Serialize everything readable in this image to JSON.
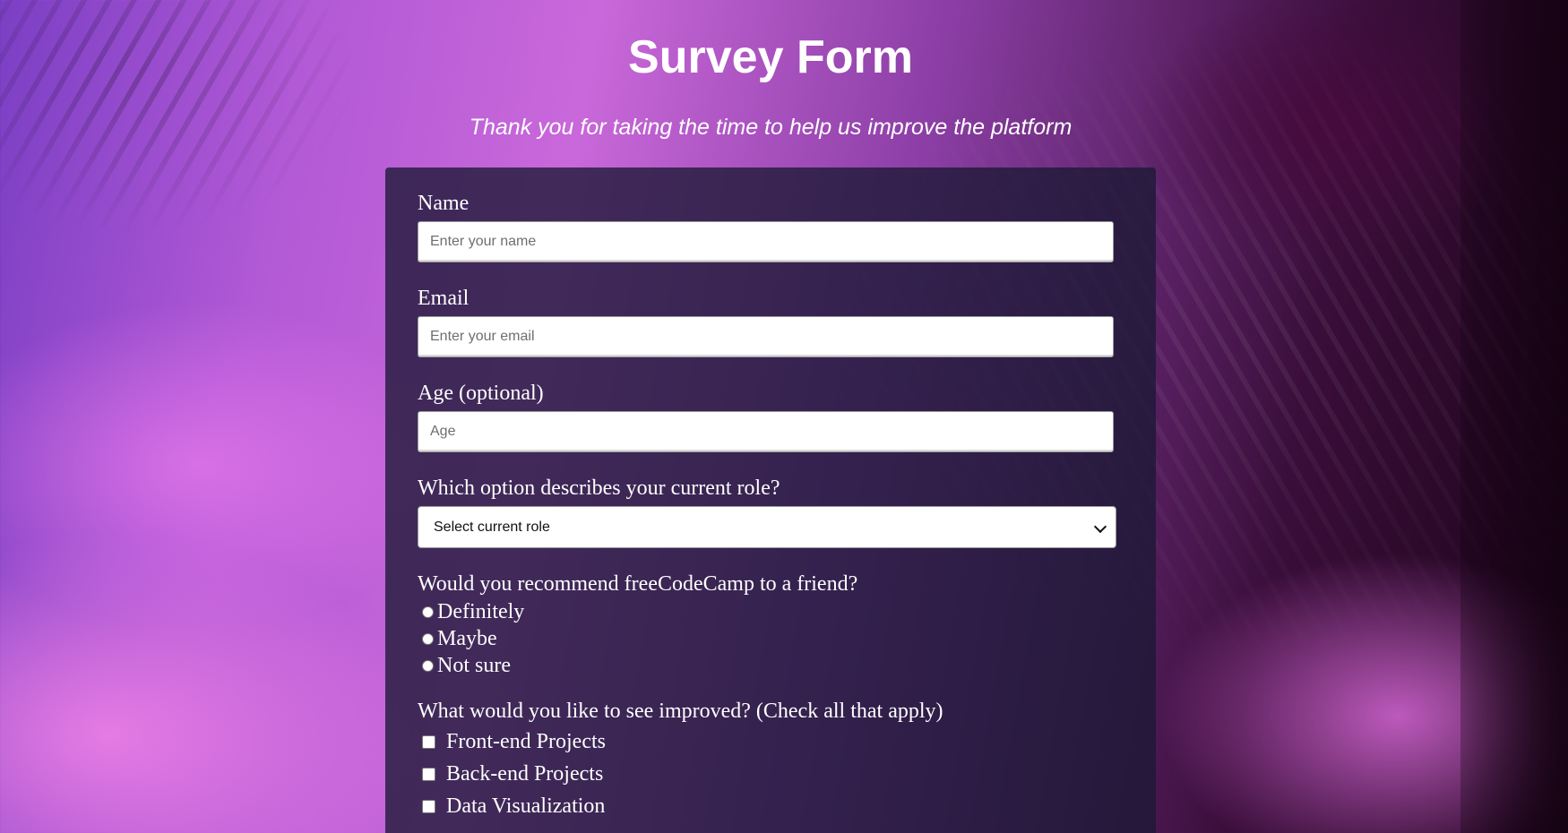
{
  "page": {
    "title": "Survey Form",
    "description": "Thank you for taking the time to help us improve the platform"
  },
  "form": {
    "name": {
      "label": "Name",
      "placeholder": "Enter your name",
      "value": ""
    },
    "email": {
      "label": "Email",
      "placeholder": "Enter your email",
      "value": ""
    },
    "age": {
      "label": "Age (optional)",
      "placeholder": "Age",
      "value": ""
    },
    "role": {
      "label": "Which option describes your current role?",
      "selected": "Select current role"
    },
    "recommend": {
      "label": "Would you recommend freeCodeCamp to a friend?",
      "options": [
        "Definitely",
        "Maybe",
        "Not sure"
      ]
    },
    "improve": {
      "label": "What would you like to see improved? (Check all that apply)",
      "options": [
        "Front-end Projects",
        "Back-end Projects",
        "Data Visualization"
      ]
    }
  },
  "icons": {
    "select_arrow": "chevron-down-icon"
  },
  "colors": {
    "form_background": "#1b1834",
    "text": "#ffffff"
  }
}
